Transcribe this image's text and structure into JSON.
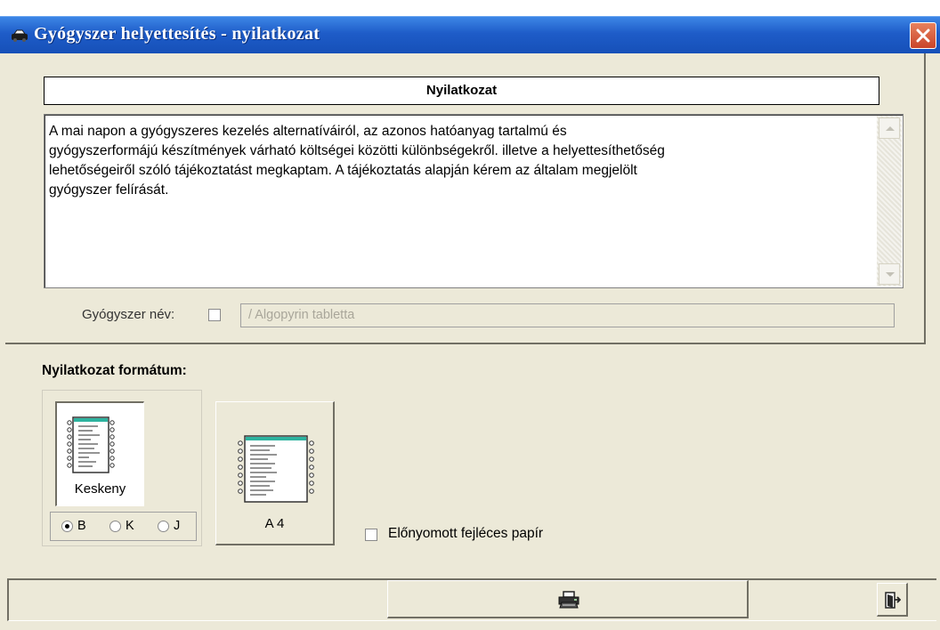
{
  "window": {
    "title": "Gyógyszer helyettesítés - nyilatkozat",
    "icons": {
      "app": "car-icon",
      "close": "close-icon"
    }
  },
  "statement": {
    "header": "Nyilatkozat",
    "lines": [
      "A mai napon a gyógyszeres kezelés alternatíváiról, az azonos hatóanyag tartalmú és",
      "gyógyszerformájú készítmények várható  költségei közötti különbségekről. illetve a helyettesíthetőség",
      "lehetőségeiről szóló tájékoztatást megkaptam. A tájékoztatás alapján kérem az általam megjelölt",
      "gyógyszer felírását."
    ]
  },
  "drug": {
    "label": "Gyógyszer név:",
    "checked": false,
    "value": "/ Algopyrin tabletta"
  },
  "format": {
    "label": "Nyilatkozat formátum:",
    "narrow_label": "Keskeny",
    "a4_label": "A 4",
    "radios": [
      {
        "label": "B",
        "selected": true
      },
      {
        "label": "K",
        "selected": false
      },
      {
        "label": "J",
        "selected": false
      }
    ],
    "preprinted_label": "Előnyomott fejléces papír",
    "preprinted_checked": false
  },
  "footer": {
    "icons": {
      "print": "printer-icon",
      "exit": "exit-door-icon"
    }
  },
  "colors": {
    "titlebar": "#1e5cc8",
    "body": "#ece9d8",
    "close": "#c9442a",
    "doc_header": "#2db39f"
  }
}
